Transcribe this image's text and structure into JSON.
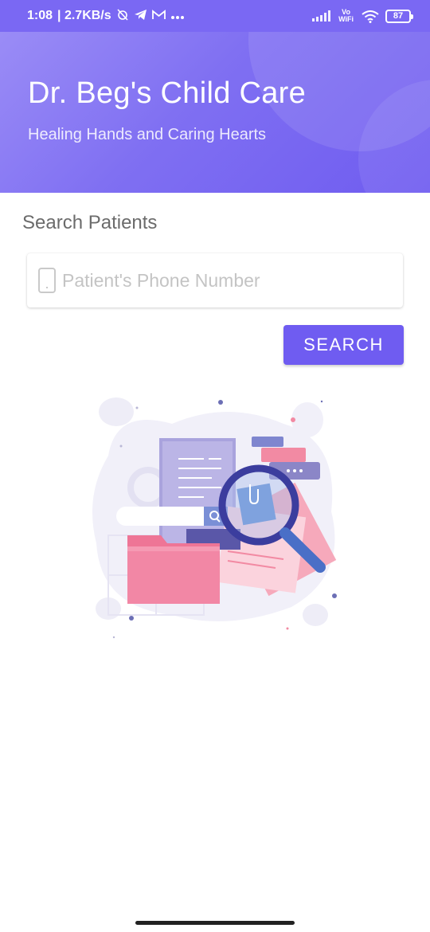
{
  "status_bar": {
    "time": "1:08",
    "net_speed": "| 2.7KB/s",
    "vowifi_top": "Vo",
    "vowifi_bottom": "WiFi",
    "battery": "87",
    "icons": [
      "alarm-off-icon",
      "telegram-icon",
      "gmail-icon",
      "more-icon",
      "signal-icon",
      "vowifi-icon",
      "wifi-icon",
      "battery-icon"
    ]
  },
  "header": {
    "title": "Dr. Beg's Child Care",
    "subtitle": "Healing Hands and Caring Hearts"
  },
  "search": {
    "section_title": "Search Patients",
    "placeholder": "Patient's Phone Number",
    "value": "",
    "button_label": "SEARCH"
  },
  "colors": {
    "accent": "#6f5cf1",
    "header_start": "#9a8cf6",
    "header_end": "#6f5cf0",
    "folder_pink": "#f07a9a",
    "lens_navy": "#3b3d9e"
  }
}
